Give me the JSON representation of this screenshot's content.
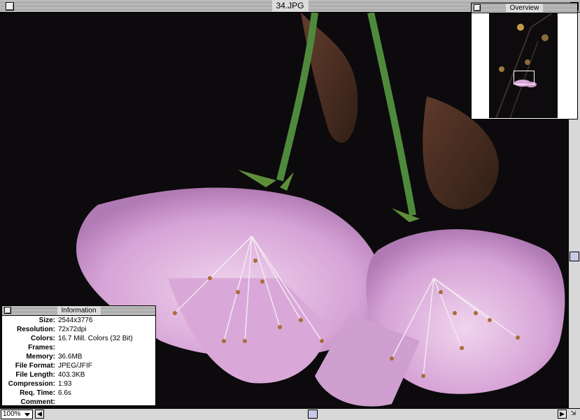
{
  "window": {
    "title": "34.JPG"
  },
  "overview": {
    "title": "Overview"
  },
  "info": {
    "title": "Information",
    "rows": [
      {
        "key": "Size:",
        "value": "2544x3776"
      },
      {
        "key": "Resolution:",
        "value": "72x72dpi"
      },
      {
        "key": "Colors:",
        "value": "16.7 Mill. Colors (32 Bit)"
      },
      {
        "key": "Frames:",
        "value": ""
      },
      {
        "key": "Memory:",
        "value": "36.6MB"
      },
      {
        "key": "File Format:",
        "value": "JPEG/JFIF"
      },
      {
        "key": "File Length:",
        "value": "403.3KB"
      },
      {
        "key": "Compression:",
        "value": "1:93"
      },
      {
        "key": "Req. Time:",
        "value": "6.6s"
      },
      {
        "key": "Comment:",
        "value": ""
      }
    ]
  },
  "statusbar": {
    "zoom": "100%"
  },
  "colors": {
    "petal": "#d9a8d8",
    "background": "#0c0a0c",
    "stem": "#4f8a3c"
  }
}
